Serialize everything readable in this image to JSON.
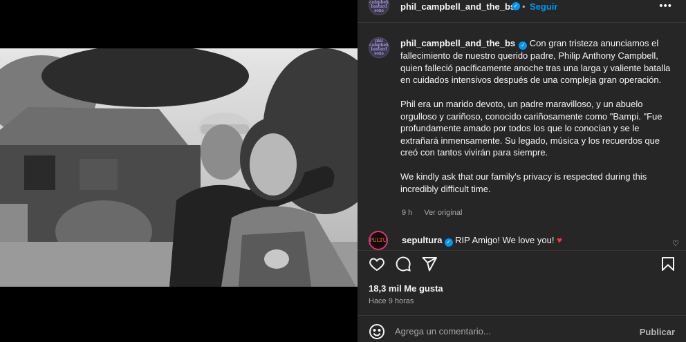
{
  "post": {
    "username": "phil_campbell_and_the_bs",
    "avatar_text": "phil campbell bastard sons",
    "follow_label": "Seguir",
    "dot": "•",
    "more_label": "•••",
    "caption_p1": "Con gran tristeza anunciamos el fallecimiento de nuestro querido padre, Philip Anthony Campbell, quien falleció pacíficamente anoche tras una larga y valiente batalla en cuidados intensivos después de una compleja gran operación.",
    "caption_p2": "Phil era un marido devoto, un padre maravilloso, y un abuelo orgulloso y cariñoso, conocido cariñosamente como \"Bampi. \"Fue profundamente amado por todos los que lo conocían y se le extrañará inmensamente. Su legado, música y los recuerdos que creó con tantos vivirán para siempre.",
    "caption_p3": "We kindly ask that our family's privacy is respected during this incredibly difficult time.",
    "time": "9 h",
    "see_original": "Ver original"
  },
  "comment": {
    "username": "sepultura",
    "avatar_text": "SEPULTURA",
    "text": "RIP Amigo! We love you!",
    "emoji": "♥"
  },
  "stats": {
    "likes": "18,3 mil Me gusta",
    "ago": "Hace 9 horas"
  },
  "add_comment": {
    "placeholder": "Agrega un comentario...",
    "post_label": "Publicar"
  },
  "icons": {
    "like": "heart-icon",
    "comment": "comment-bubble-icon",
    "share": "paper-plane-icon",
    "save": "bookmark-icon",
    "emoji": "smiley-icon",
    "more": "more-dots-icon",
    "verified": "verified-badge-icon"
  },
  "colors": {
    "panel_bg": "#262626",
    "accent_blue": "#0095f6",
    "heart_red": "#ff3040"
  }
}
